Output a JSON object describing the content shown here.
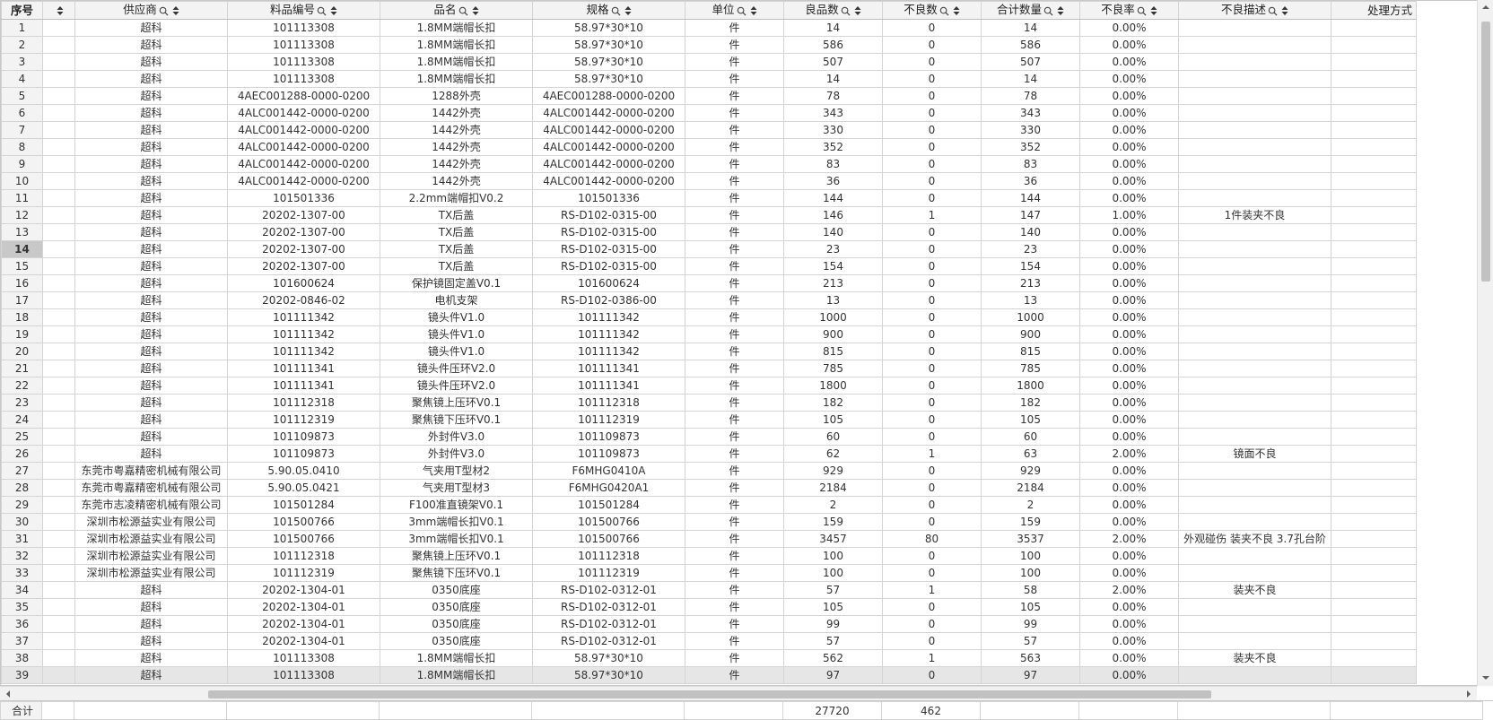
{
  "columns": [
    {
      "key": "seq",
      "label": "序号"
    },
    {
      "key": "supplier",
      "label": "供应商"
    },
    {
      "key": "part_no",
      "label": "料品编号"
    },
    {
      "key": "name",
      "label": "品名"
    },
    {
      "key": "spec",
      "label": "规格"
    },
    {
      "key": "unit",
      "label": "单位"
    },
    {
      "key": "good",
      "label": "良品数"
    },
    {
      "key": "bad",
      "label": "不良数"
    },
    {
      "key": "total",
      "label": "合计数量"
    },
    {
      "key": "rate",
      "label": "不良率"
    },
    {
      "key": "desc",
      "label": "不良描述"
    },
    {
      "key": "method",
      "label": "处理方式"
    }
  ],
  "selected_row": 14,
  "highlight_row": 39,
  "rows": [
    [
      "1",
      "超科",
      "101113308",
      "1.8MM端帽长扣",
      "58.97*30*10",
      "件",
      "14",
      "0",
      "14",
      "0.00%",
      ""
    ],
    [
      "2",
      "超科",
      "101113308",
      "1.8MM端帽长扣",
      "58.97*30*10",
      "件",
      "586",
      "0",
      "586",
      "0.00%",
      ""
    ],
    [
      "3",
      "超科",
      "101113308",
      "1.8MM端帽长扣",
      "58.97*30*10",
      "件",
      "507",
      "0",
      "507",
      "0.00%",
      ""
    ],
    [
      "4",
      "超科",
      "101113308",
      "1.8MM端帽长扣",
      "58.97*30*10",
      "件",
      "14",
      "0",
      "14",
      "0.00%",
      ""
    ],
    [
      "5",
      "超科",
      "4AEC001288-0000-0200",
      "1288外壳",
      "4AEC001288-0000-0200",
      "件",
      "78",
      "0",
      "78",
      "0.00%",
      ""
    ],
    [
      "6",
      "超科",
      "4ALC001442-0000-0200",
      "1442外壳",
      "4ALC001442-0000-0200",
      "件",
      "343",
      "0",
      "343",
      "0.00%",
      ""
    ],
    [
      "7",
      "超科",
      "4ALC001442-0000-0200",
      "1442外壳",
      "4ALC001442-0000-0200",
      "件",
      "330",
      "0",
      "330",
      "0.00%",
      ""
    ],
    [
      "8",
      "超科",
      "4ALC001442-0000-0200",
      "1442外壳",
      "4ALC001442-0000-0200",
      "件",
      "352",
      "0",
      "352",
      "0.00%",
      ""
    ],
    [
      "9",
      "超科",
      "4ALC001442-0000-0200",
      "1442外壳",
      "4ALC001442-0000-0200",
      "件",
      "83",
      "0",
      "83",
      "0.00%",
      ""
    ],
    [
      "10",
      "超科",
      "4ALC001442-0000-0200",
      "1442外壳",
      "4ALC001442-0000-0200",
      "件",
      "36",
      "0",
      "36",
      "0.00%",
      ""
    ],
    [
      "11",
      "超科",
      "101501336",
      "2.2mm端帽扣V0.2",
      "101501336",
      "件",
      "144",
      "0",
      "144",
      "0.00%",
      ""
    ],
    [
      "12",
      "超科",
      "20202-1307-00",
      "TX后盖",
      "RS-D102-0315-00",
      "件",
      "146",
      "1",
      "147",
      "1.00%",
      "1件装夹不良"
    ],
    [
      "13",
      "超科",
      "20202-1307-00",
      "TX后盖",
      "RS-D102-0315-00",
      "件",
      "140",
      "0",
      "140",
      "0.00%",
      ""
    ],
    [
      "14",
      "超科",
      "20202-1307-00",
      "TX后盖",
      "RS-D102-0315-00",
      "件",
      "23",
      "0",
      "23",
      "0.00%",
      ""
    ],
    [
      "15",
      "超科",
      "20202-1307-00",
      "TX后盖",
      "RS-D102-0315-00",
      "件",
      "154",
      "0",
      "154",
      "0.00%",
      ""
    ],
    [
      "16",
      "超科",
      "101600624",
      "保护镜固定盖V0.1",
      "101600624",
      "件",
      "213",
      "0",
      "213",
      "0.00%",
      ""
    ],
    [
      "17",
      "超科",
      "20202-0846-02",
      "电机支架",
      "RS-D102-0386-00",
      "件",
      "13",
      "0",
      "13",
      "0.00%",
      ""
    ],
    [
      "18",
      "超科",
      "101111342",
      "镜头件V1.0",
      "101111342",
      "件",
      "1000",
      "0",
      "1000",
      "0.00%",
      ""
    ],
    [
      "19",
      "超科",
      "101111342",
      "镜头件V1.0",
      "101111342",
      "件",
      "900",
      "0",
      "900",
      "0.00%",
      ""
    ],
    [
      "20",
      "超科",
      "101111342",
      "镜头件V1.0",
      "101111342",
      "件",
      "815",
      "0",
      "815",
      "0.00%",
      ""
    ],
    [
      "21",
      "超科",
      "101111341",
      "镜头件压环V2.0",
      "101111341",
      "件",
      "785",
      "0",
      "785",
      "0.00%",
      ""
    ],
    [
      "22",
      "超科",
      "101111341",
      "镜头件压环V2.0",
      "101111341",
      "件",
      "1800",
      "0",
      "1800",
      "0.00%",
      ""
    ],
    [
      "23",
      "超科",
      "101112318",
      "聚焦镜上压环V0.1",
      "101112318",
      "件",
      "182",
      "0",
      "182",
      "0.00%",
      ""
    ],
    [
      "24",
      "超科",
      "101112319",
      "聚焦镜下压环V0.1",
      "101112319",
      "件",
      "105",
      "0",
      "105",
      "0.00%",
      ""
    ],
    [
      "25",
      "超科",
      "101109873",
      "外封件V3.0",
      "101109873",
      "件",
      "60",
      "0",
      "60",
      "0.00%",
      ""
    ],
    [
      "26",
      "超科",
      "101109873",
      "外封件V3.0",
      "101109873",
      "件",
      "62",
      "1",
      "63",
      "2.00%",
      "镜面不良"
    ],
    [
      "27",
      "东莞市粤嘉精密机械有限公司",
      "5.90.05.0410",
      "气夹用T型材2",
      "F6MHG0410A",
      "件",
      "929",
      "0",
      "929",
      "0.00%",
      ""
    ],
    [
      "28",
      "东莞市粤嘉精密机械有限公司",
      "5.90.05.0421",
      "气夹用T型材3",
      "F6MHG0420A1",
      "件",
      "2184",
      "0",
      "2184",
      "0.00%",
      ""
    ],
    [
      "29",
      "东莞市志凌精密机械有限公司",
      "101501284",
      "F100准直镜架V0.1",
      "101501284",
      "件",
      "2",
      "0",
      "2",
      "0.00%",
      ""
    ],
    [
      "30",
      "深圳市松源益实业有限公司",
      "101500766",
      "3mm端帽长扣V0.1",
      "101500766",
      "件",
      "159",
      "0",
      "159",
      "0.00%",
      ""
    ],
    [
      "31",
      "深圳市松源益实业有限公司",
      "101500766",
      "3mm端帽长扣V0.1",
      "101500766",
      "件",
      "3457",
      "80",
      "3537",
      "2.00%",
      "外观碰伤 装夹不良 3.7孔台阶"
    ],
    [
      "32",
      "深圳市松源益实业有限公司",
      "101112318",
      "聚焦镜上压环V0.1",
      "101112318",
      "件",
      "100",
      "0",
      "100",
      "0.00%",
      ""
    ],
    [
      "33",
      "深圳市松源益实业有限公司",
      "101112319",
      "聚焦镜下压环V0.1",
      "101112319",
      "件",
      "100",
      "0",
      "100",
      "0.00%",
      ""
    ],
    [
      "34",
      "超科",
      "20202-1304-01",
      "0350底座",
      "RS-D102-0312-01",
      "件",
      "57",
      "1",
      "58",
      "2.00%",
      "装夹不良"
    ],
    [
      "35",
      "超科",
      "20202-1304-01",
      "0350底座",
      "RS-D102-0312-01",
      "件",
      "105",
      "0",
      "105",
      "0.00%",
      ""
    ],
    [
      "36",
      "超科",
      "20202-1304-01",
      "0350底座",
      "RS-D102-0312-01",
      "件",
      "99",
      "0",
      "99",
      "0.00%",
      ""
    ],
    [
      "37",
      "超科",
      "20202-1304-01",
      "0350底座",
      "RS-D102-0312-01",
      "件",
      "57",
      "0",
      "57",
      "0.00%",
      ""
    ],
    [
      "38",
      "超科",
      "101113308",
      "1.8MM端帽长扣",
      "58.97*30*10",
      "件",
      "562",
      "1",
      "563",
      "0.00%",
      "装夹不良"
    ],
    [
      "39",
      "超科",
      "101113308",
      "1.8MM端帽长扣",
      "58.97*30*10",
      "件",
      "97",
      "0",
      "97",
      "0.00%",
      ""
    ]
  ],
  "footer": {
    "label": "合计",
    "good_total": "27720",
    "bad_total": "462"
  }
}
